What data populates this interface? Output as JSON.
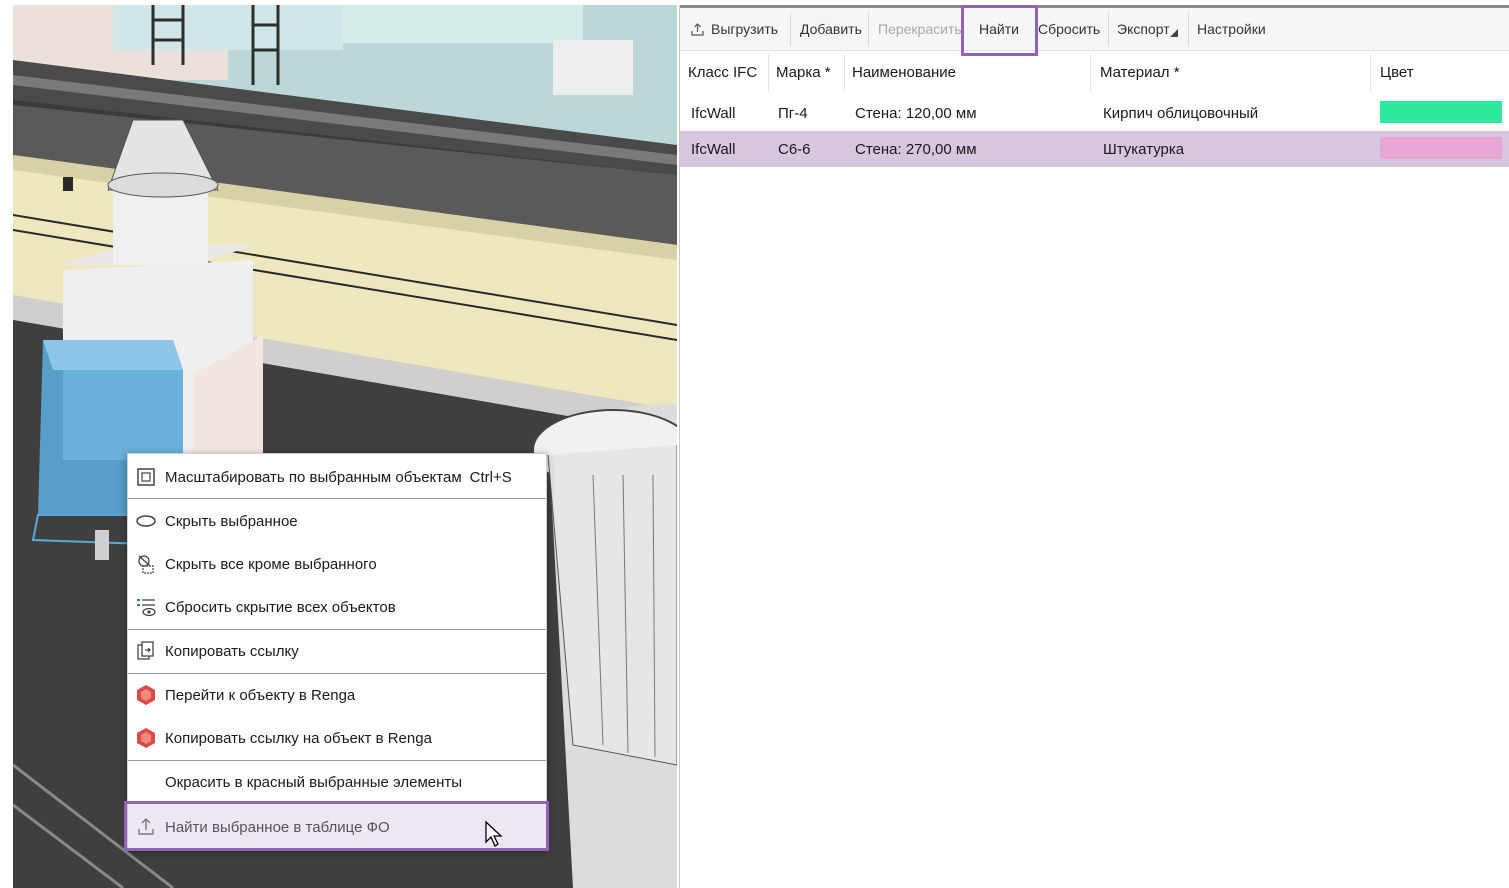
{
  "context_menu": {
    "items": [
      {
        "label": "Масштабировать по выбранным объектам",
        "shortcut": "Ctrl+S",
        "icon": "zoom-to-selection-icon"
      },
      {
        "label": "Скрыть выбранное",
        "icon": "eye-hide-icon"
      },
      {
        "label": "Скрыть все кроме выбранного",
        "icon": "isolate-selection-icon"
      },
      {
        "label": "Сбросить скрытие всех объектов",
        "icon": "show-all-icon"
      },
      {
        "label": "Копировать ссылку",
        "icon": "copy-link-icon"
      },
      {
        "label": "Перейти к объекту в Renga",
        "icon": "renga-logo-icon"
      },
      {
        "label": "Копировать ссылку на объект в Renga",
        "icon": "renga-logo-icon"
      },
      {
        "label": "Окрасить в красный выбранные элементы",
        "icon": ""
      },
      {
        "label": "Найти выбранное в таблице ФО",
        "icon": "upload-icon"
      }
    ]
  },
  "toolbar": {
    "unload": "Выгрузить",
    "add": "Добавить",
    "recolor": "Перекрасить",
    "find": "Найти",
    "reset": "Сбросить",
    "export": "Экспорт",
    "settings": "Настройки"
  },
  "table": {
    "columns": [
      "Класс IFC",
      "Марка *",
      "Наименование",
      "Материал *",
      "Цвет"
    ],
    "rows": [
      {
        "ifc_class": "IfcWall",
        "mark": "Пг-4",
        "name": "Стена: 120,00 мм",
        "material": "Кирпич облицовочный",
        "color": "#2ee89c",
        "selected": false
      },
      {
        "ifc_class": "IfcWall",
        "mark": "С6-6",
        "name": "Стена: 270,00 мм",
        "material": "Штукатурка",
        "color": "#e8a6d6",
        "selected": true
      }
    ]
  },
  "colors": {
    "highlight_border": "#8f63b5",
    "selected_row": "#d7c6df",
    "selected_object": "#5aa8d8"
  }
}
